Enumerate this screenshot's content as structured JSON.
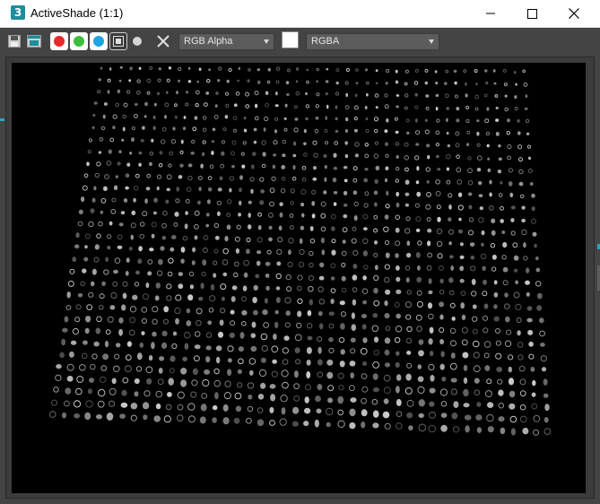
{
  "window": {
    "title": "ActiveShade (1:1)",
    "app_icon_label": "3"
  },
  "title_buttons": {
    "minimize_icon": "minimize-icon",
    "maximize_icon": "maximize-icon",
    "close_icon": "close-icon"
  },
  "toolbar": {
    "save_icon": "save-icon",
    "clone_icon": "clone-window-icon",
    "channels": [
      {
        "name": "red-channel",
        "color": "#e8282b"
      },
      {
        "name": "green-channel",
        "color": "#3cbf3c"
      },
      {
        "name": "blue-channel",
        "color": "#1ea4e0"
      }
    ],
    "monochrome_icon": "monochrome-icon",
    "display_alpha_icon": "display-alpha-icon",
    "clear_icon": "clear-icon",
    "channel_select": "RGB Alpha",
    "swatch_color": "#ffffff",
    "display_select": "RGBA"
  },
  "render": {
    "description_color_bg": "#000000",
    "dot_color": "#d8d8d8"
  }
}
